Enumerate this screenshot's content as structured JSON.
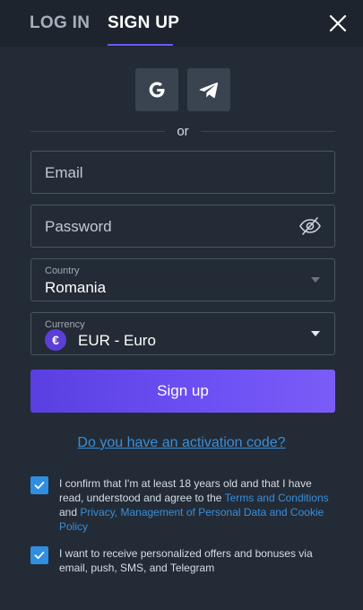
{
  "header": {
    "login_tab": "LOG IN",
    "signup_tab": "SIGN UP"
  },
  "social": {
    "google_icon": "google-icon",
    "telegram_icon": "telegram-icon"
  },
  "divider": {
    "or": "or"
  },
  "form": {
    "email_placeholder": "Email",
    "password_placeholder": "Password",
    "country_label": "Country",
    "country_value": "Romania",
    "currency_label": "Currency",
    "currency_symbol": "€",
    "currency_value": "EUR - Euro",
    "submit_label": "Sign up"
  },
  "activation_link": "Do you have an activation code?",
  "consents": {
    "age": {
      "checked": true,
      "prefix": "I confirm that I'm at least 18 years old and that I have read, understood and agree to the ",
      "terms_link": "Terms and Conditions",
      "middle": " and ",
      "privacy_link": "Privacy, Management of Personal Data and Cookie Policy"
    },
    "offers": {
      "checked": true,
      "text": "I want to receive personalized offers and bonuses via email, push, SMS, and Telegram"
    }
  },
  "colors": {
    "background": "#232b36",
    "accent": "#6a4ef2",
    "link": "#3a8ed8",
    "checkbox": "#2f8ee0"
  }
}
